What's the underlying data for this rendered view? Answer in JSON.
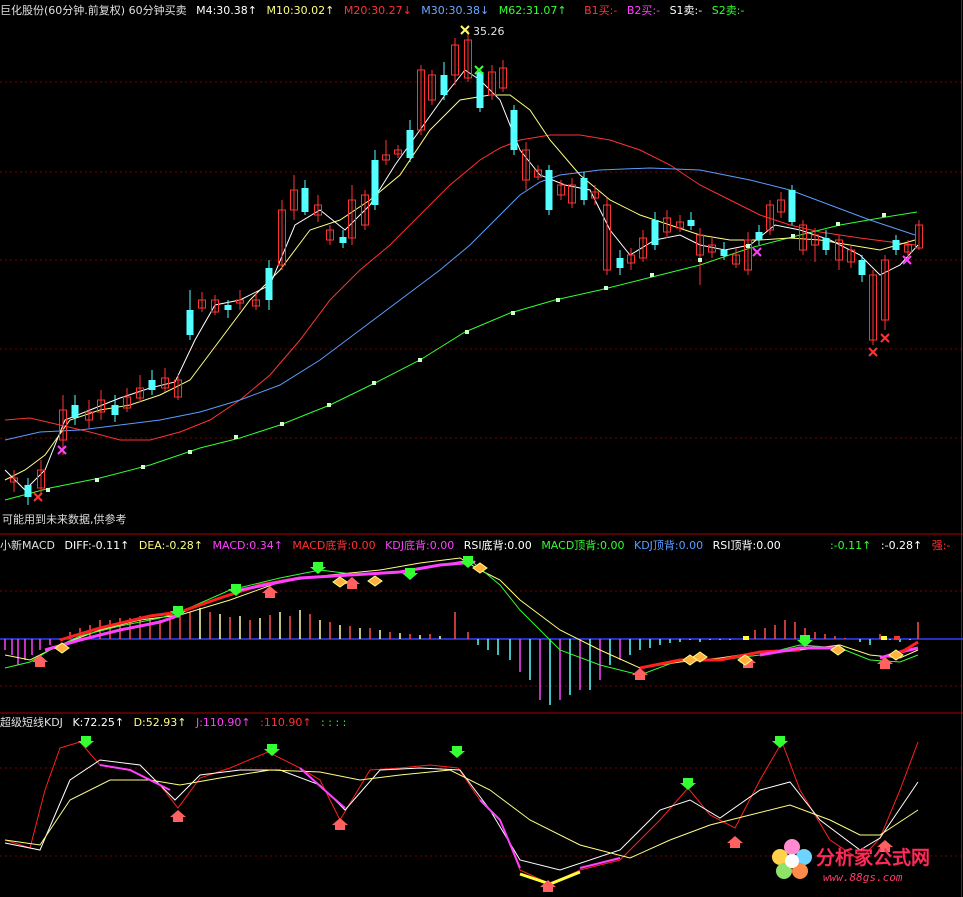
{
  "main": {
    "title": "巨化股份(60分钟.前复权) 60分钟买卖",
    "m4": "M4:30.38↑",
    "m10": "M10:30.02↑",
    "m20": "M20:30.27↓",
    "m30": "M30:30.38↓",
    "m62": "M62:31.07↑",
    "b1": "B1买:-",
    "b2": "B2买:-",
    "s1": "S1卖:-",
    "s2": "S2卖:-",
    "high_label": "35.26",
    "note": "可能用到未来数据,供参考",
    "colors": {
      "up": "#ff3232",
      "down": "#54ffff",
      "m4": "#ffffff",
      "m10": "#ffff80",
      "m20": "#ff3232",
      "m30": "#5a9cff",
      "m62": "#33ff33"
    }
  },
  "macd": {
    "title": "小新MACD",
    "diff": "DIFF:-0.11↑",
    "dea": "DEA:-0.28↑",
    "macd": "MACD:0.34↑",
    "macd_bottom": "MACD底背:0.00",
    "kdj_bottom": "KDJ底背:0.00",
    "rsi_bottom": "RSI底背:0.00",
    "macd_top": "MACD顶背:0.00",
    "kdj_top": "KDJ顶背:0.00",
    "rsi_top": "RSI顶背:0.00",
    "r1": ":-0.11↑",
    "r2": ":-0.28↑",
    "strong": "强:-"
  },
  "kdj": {
    "title": "超级短线KDJ",
    "k": "K:72.25↑",
    "d": "D:52.93↑",
    "j": "J:110.90↑",
    "extra": ":110.90↑",
    "dots": ": : : :"
  },
  "watermark": {
    "title": "分析家公式网",
    "url": "www.88gs.com"
  }
}
